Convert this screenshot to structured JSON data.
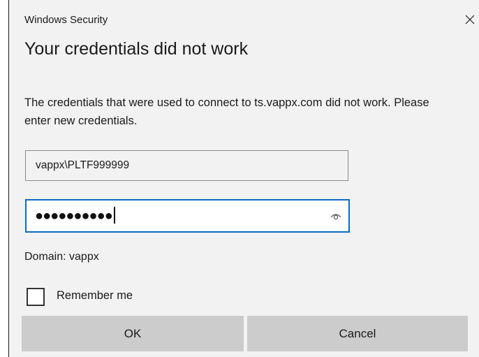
{
  "window": {
    "app_title": "Windows Security",
    "close_icon": "close-icon"
  },
  "dialog": {
    "heading": "Your credentials did not work",
    "message": "The credentials that were used to connect to ts.vappx.com did not work. Please enter new credentials.",
    "username_value": "vappx\\PLTF999999",
    "password_masked": "●●●●●●●●●●",
    "reveal_icon": "eye-icon",
    "domain_text": "Domain: vappx",
    "remember_label": "Remember me",
    "remember_checked": false,
    "ok_label": "OK",
    "cancel_label": "Cancel"
  },
  "colors": {
    "dialog_bg": "#f2f2f2",
    "focus_border": "#0a6cc4",
    "button_bg": "#cccccc"
  }
}
